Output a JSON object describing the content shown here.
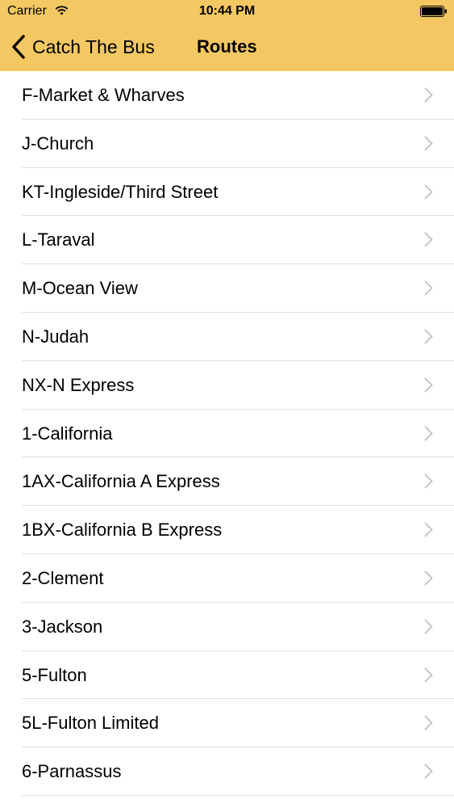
{
  "status_bar": {
    "carrier": "Carrier",
    "time": "10:44 PM"
  },
  "nav": {
    "back_label": "Catch The Bus",
    "title": "Routes"
  },
  "colors": {
    "header_bg": "#f3c862",
    "chevron": "#c7c7cc",
    "separator": "#e0e0e0"
  },
  "routes": [
    "F-Market & Wharves",
    "J-Church",
    "KT-Ingleside/Third Street",
    "L-Taraval",
    "M-Ocean View",
    "N-Judah",
    "NX-N Express",
    "1-California",
    "1AX-California A Express",
    "1BX-California B Express",
    "2-Clement",
    "3-Jackson",
    "5-Fulton",
    "5L-Fulton Limited",
    "6-Parnassus"
  ]
}
